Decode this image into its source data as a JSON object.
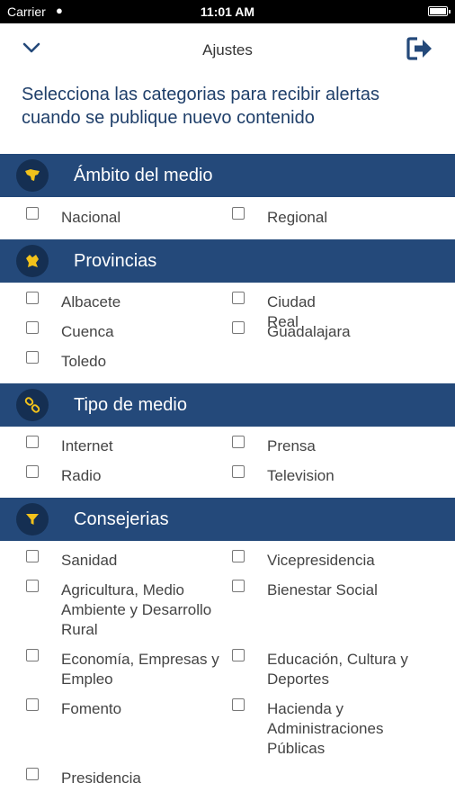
{
  "status_bar": {
    "carrier": "Carrier",
    "time": "11:01 AM"
  },
  "nav": {
    "title": "Ajustes"
  },
  "intro": "Selecciona las categorias para recibir alertas cuando se publique nuevo contenido",
  "sections": {
    "ambito": {
      "title": "Ámbito del medio",
      "options": [
        "Nacional",
        "Regional"
      ]
    },
    "provincias": {
      "title": "Provincias",
      "options": [
        "Albacete",
        "Ciudad Real",
        "Cuenca",
        "Guadalajara",
        "Toledo"
      ]
    },
    "tipo": {
      "title": "Tipo de medio",
      "options": [
        "Internet",
        "Prensa",
        "Radio",
        "Television"
      ]
    },
    "consejerias": {
      "title": "Consejerias",
      "options": [
        "Sanidad",
        "Vicepresidencia",
        "Agricultura, Medio Ambiente y Desarrollo Rural",
        "Bienestar Social",
        "Economía, Empresas y Empleo",
        "Educación, Cultura y Deportes",
        "Fomento",
        "Hacienda y Administraciones Públicas",
        "Presidencia"
      ]
    }
  },
  "colors": {
    "header_bg": "#24497a",
    "icon_circle": "#152f52",
    "icon_accent": "#f2c21b",
    "intro_text": "#1f3f6a"
  },
  "icons": {
    "back": "chevron-down-icon",
    "logout": "logout-icon",
    "ambito": "map-icon",
    "provincias": "map-region-icon",
    "tipo": "link-icon",
    "consejerias": "filter-icon"
  }
}
